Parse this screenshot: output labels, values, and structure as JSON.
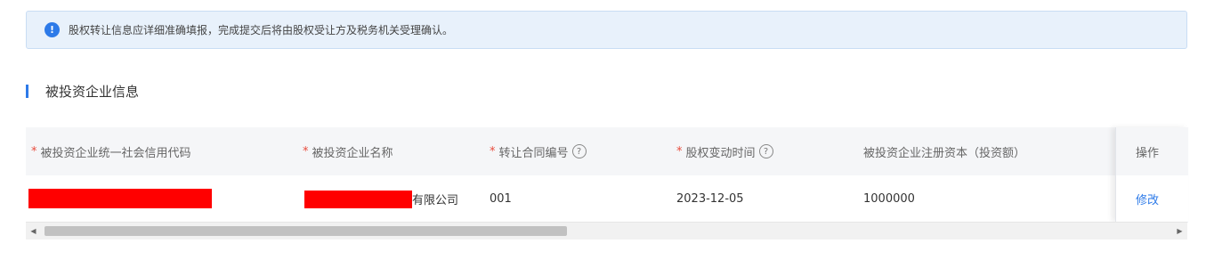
{
  "alert": {
    "icon": "info-icon",
    "text": "股权转让信息应详细准确填报，完成提交后将由股权受让方及税务机关受理确认。"
  },
  "section": {
    "title": "被投资企业信息"
  },
  "table": {
    "columns": [
      {
        "label": "被投资企业统一社会信用代码",
        "required": true,
        "help": false
      },
      {
        "label": "被投资企业名称",
        "required": true,
        "help": false
      },
      {
        "label": "转让合同编号",
        "required": true,
        "help": true
      },
      {
        "label": "股权变动时间",
        "required": true,
        "help": true
      },
      {
        "label": "被投资企业注册资本（投资额）",
        "required": false,
        "help": false
      },
      {
        "label": "操作",
        "required": false,
        "help": false
      }
    ],
    "rows": [
      {
        "credit_code": "",
        "company_name_suffix": "有限公司",
        "contract_no": "001",
        "change_date": "2023-12-05",
        "registered_capital": "1000000",
        "action": "修改"
      }
    ]
  },
  "symbols": {
    "required": "*",
    "help": "?",
    "scroll_left": "◀",
    "scroll_right": "▶"
  },
  "colors": {
    "accent": "#2d7ae8",
    "alert_bg": "#e8f1fb",
    "required": "#e84c3d",
    "redaction": "#ff0000"
  }
}
